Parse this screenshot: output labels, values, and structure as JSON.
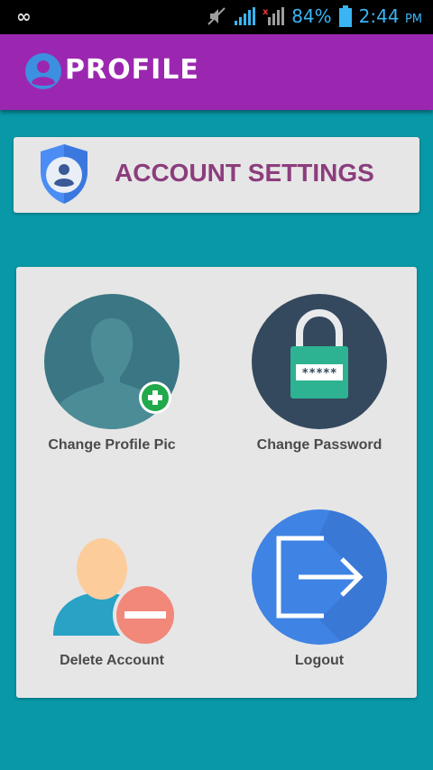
{
  "status_bar": {
    "left_icon": "infinity-icon",
    "battery_percent": "84%",
    "time": "2:44",
    "ampm": "PM"
  },
  "app_bar": {
    "title": "PROFILE",
    "icon": "user-circle-icon",
    "background": "#9b27b0"
  },
  "settings_header": {
    "title": "ACCOUNT SETTINGS",
    "icon": "shield-user-icon",
    "title_color": "#8c3d7d"
  },
  "tiles": [
    {
      "label": "Change Profile Pic",
      "icon": "add-profile-picture-icon"
    },
    {
      "label": "Change Password",
      "icon": "padlock-icon",
      "password_mask": "*****"
    },
    {
      "label": "Delete Account",
      "icon": "remove-user-icon"
    },
    {
      "label": "Logout",
      "icon": "logout-icon"
    }
  ],
  "colors": {
    "page_background": "#0898a8",
    "card_background": "#e6e6e6"
  }
}
